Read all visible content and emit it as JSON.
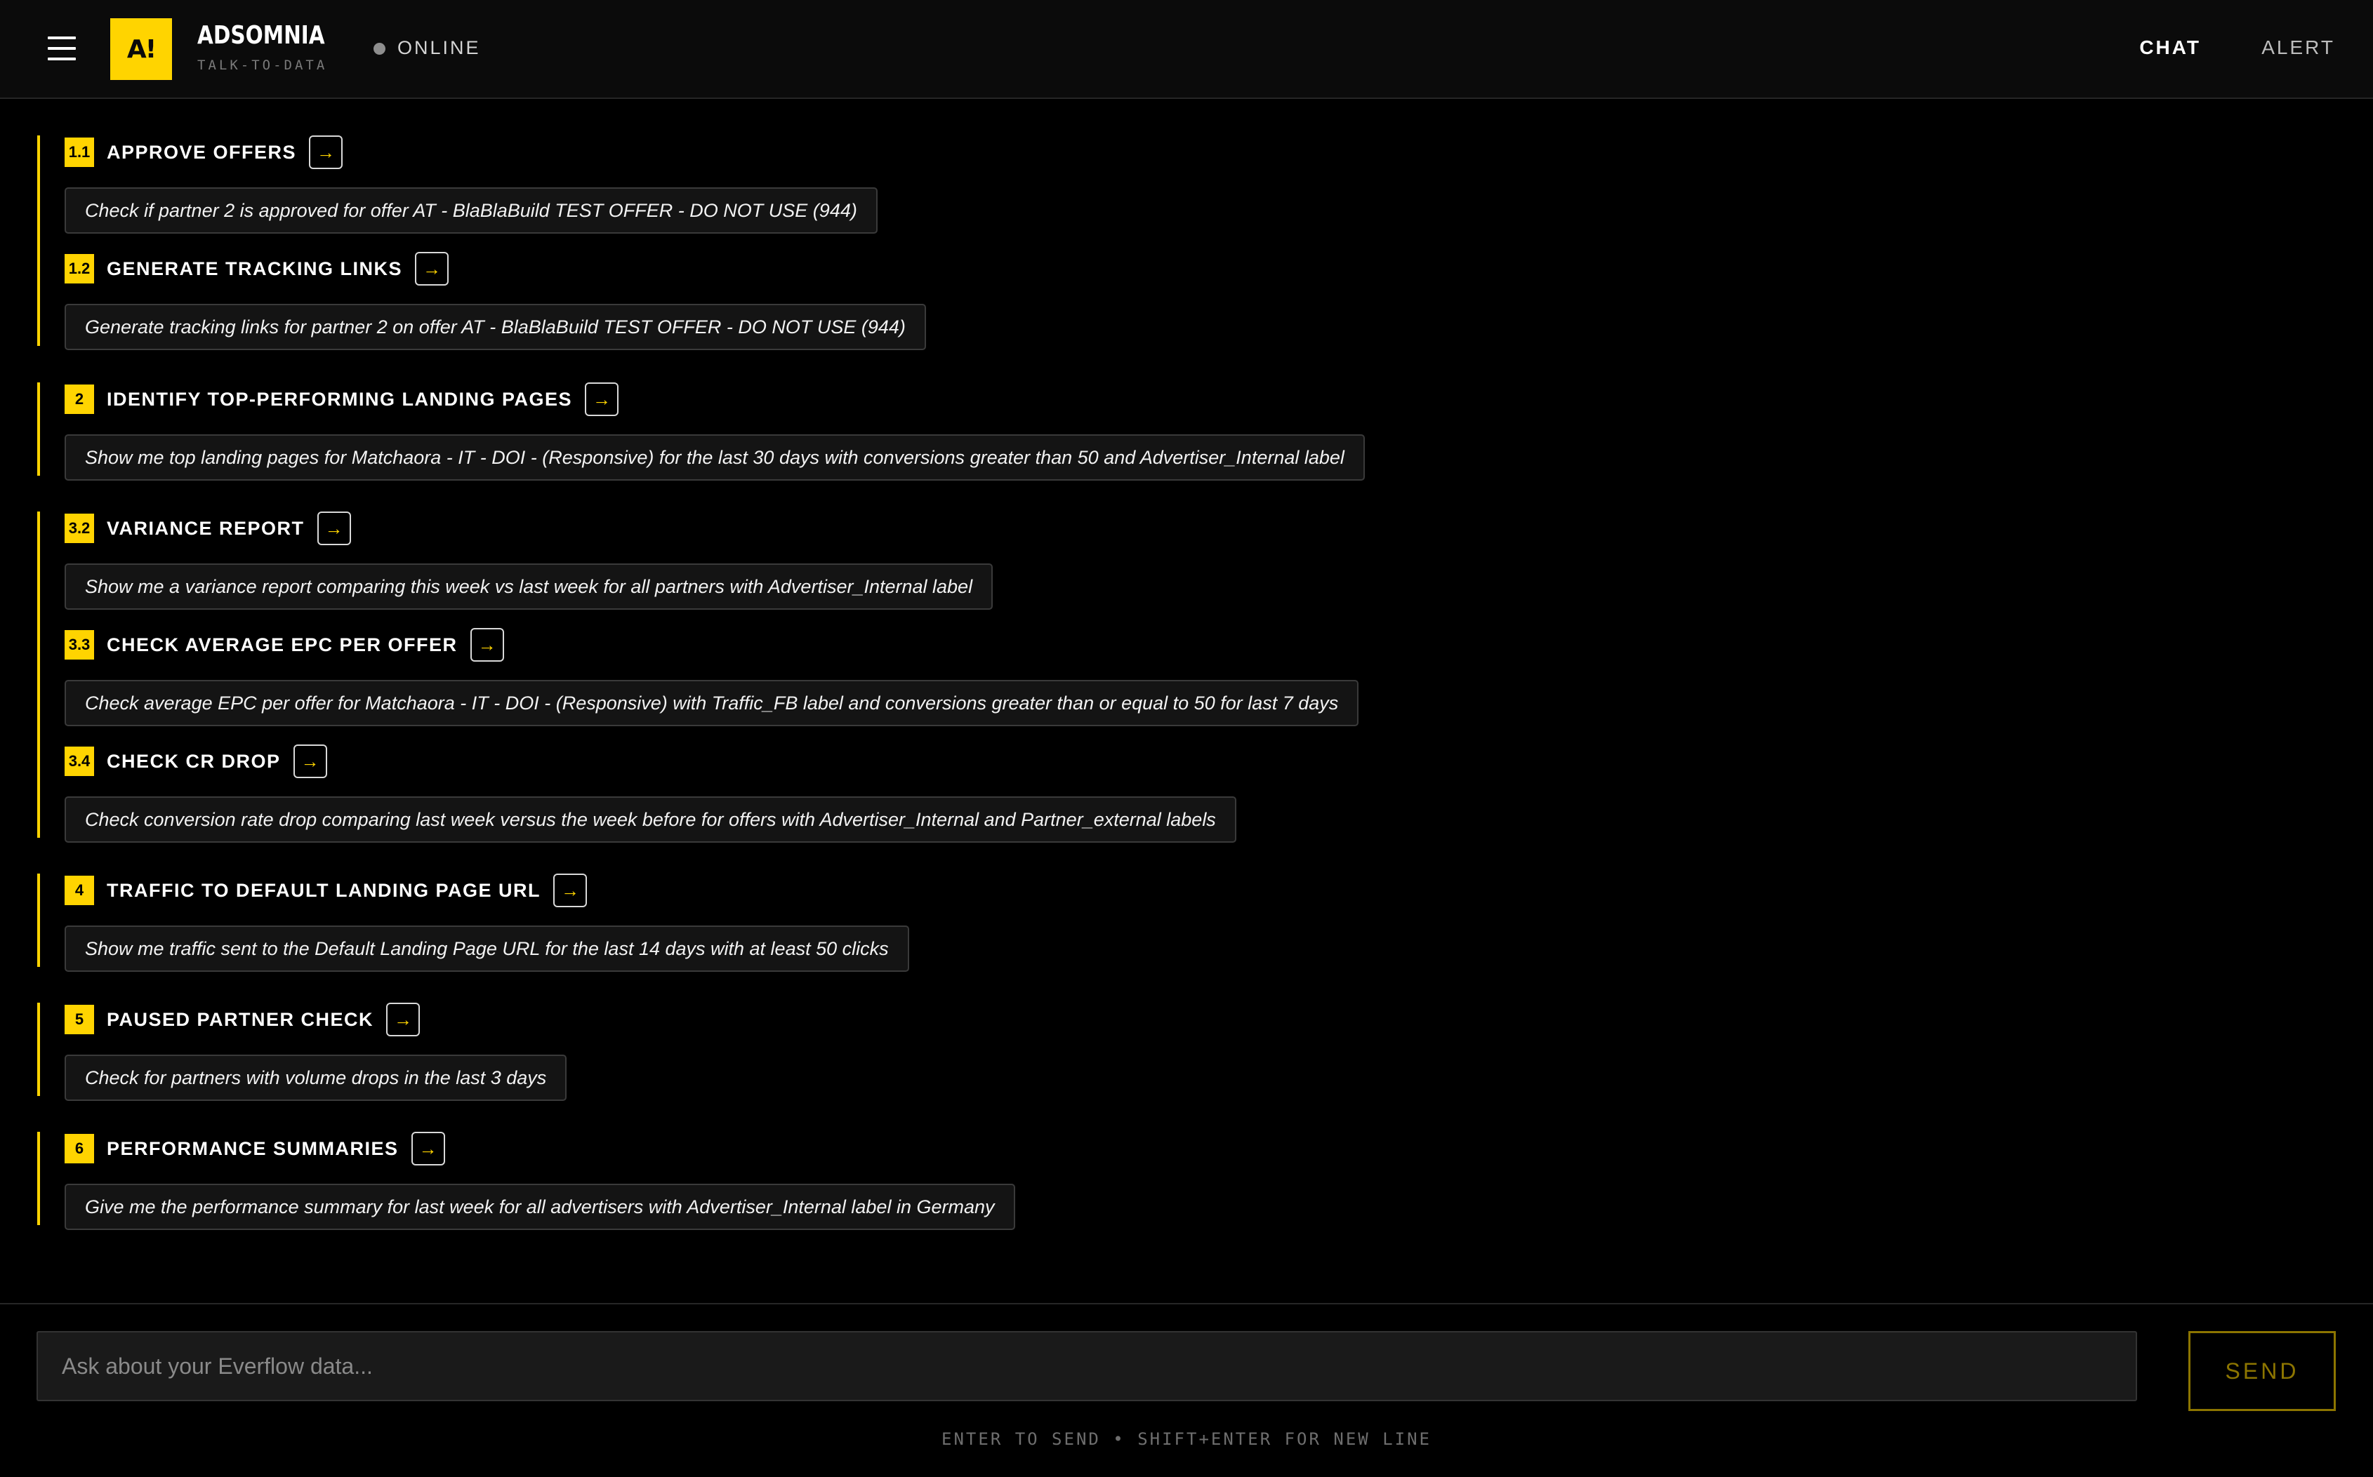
{
  "header": {
    "logo_text": "A!",
    "brand_name": "ADSOMNIA",
    "brand_sub": "TALK-TO-DATA",
    "status": "ONLINE",
    "nav": {
      "chat": "CHAT",
      "alert": "ALERT"
    }
  },
  "colors": {
    "accent": "#ffd400",
    "background": "#000000",
    "header_bg": "#0b0b0b",
    "prompt_bg": "#141414",
    "send_button": "#8c7500"
  },
  "icons": {
    "menu": "hamburger-menu-icon",
    "go": "arrow-right-icon",
    "status": "status-dot-icon"
  },
  "suggestions": {
    "g1": {
      "i1": {
        "number": "1.1",
        "title": "APPROVE OFFERS",
        "prompt": "Check if partner 2 is approved for offer AT - BlaBlaBuild TEST OFFER - DO NOT USE (944)"
      },
      "i2": {
        "number": "1.2",
        "title": "GENERATE TRACKING LINKS",
        "prompt": "Generate tracking links for partner 2 on offer AT - BlaBlaBuild TEST OFFER - DO NOT USE (944)"
      }
    },
    "g2": {
      "i1": {
        "number": "2",
        "title": "IDENTIFY TOP-PERFORMING LANDING PAGES",
        "prompt": "Show me top landing pages for Matchaora - IT - DOI - (Responsive) for the last 30 days with conversions greater than 50 and Advertiser_Internal label"
      }
    },
    "g3": {
      "i1": {
        "number": "3.2",
        "title": "VARIANCE REPORT",
        "prompt": "Show me a variance report comparing this week vs last week for all partners with Advertiser_Internal label"
      },
      "i2": {
        "number": "3.3",
        "title": "CHECK AVERAGE EPC PER OFFER",
        "prompt": "Check average EPC per offer for Matchaora - IT - DOI - (Responsive) with Traffic_FB label and conversions greater than or equal to 50 for last 7 days"
      },
      "i3": {
        "number": "3.4",
        "title": "CHECK CR DROP",
        "prompt": "Check conversion rate drop comparing last week versus the week before for offers with Advertiser_Internal and Partner_external labels"
      }
    },
    "g4": {
      "i1": {
        "number": "4",
        "title": "TRAFFIC TO DEFAULT LANDING PAGE URL",
        "prompt": "Show me traffic sent to the Default Landing Page URL for the last 14 days with at least 50 clicks"
      }
    },
    "g5": {
      "i1": {
        "number": "5",
        "title": "PAUSED PARTNER CHECK",
        "prompt": "Check for partners with volume drops in the last 3 days"
      }
    },
    "g6": {
      "i1": {
        "number": "6",
        "title": "PERFORMANCE SUMMARIES",
        "prompt": "Give me the performance summary for last week for all advertisers with Advertiser_Internal label in Germany"
      }
    }
  },
  "input": {
    "placeholder": "Ask about your Everflow data...",
    "value": ""
  },
  "send_label": "SEND",
  "hint": "ENTER TO SEND • SHIFT+ENTER FOR NEW LINE"
}
